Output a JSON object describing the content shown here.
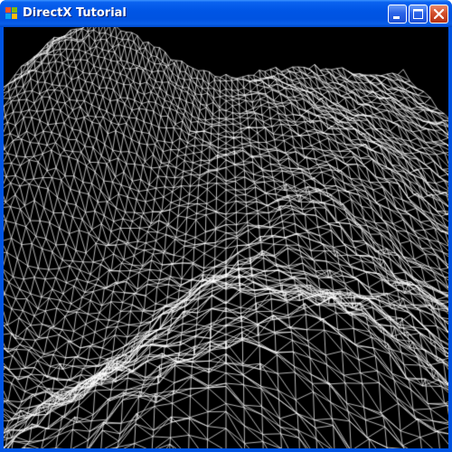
{
  "window": {
    "title": "DirectX Tutorial",
    "controls": {
      "minimize": "minimize",
      "maximize": "maximize",
      "close": "close"
    }
  },
  "viewport": {
    "background": "#000000",
    "wire_color": "#ffffff",
    "content": "wireframe-terrain"
  },
  "colors": {
    "titlebar_accent": "#0054e3",
    "close_button": "#d3502c"
  }
}
